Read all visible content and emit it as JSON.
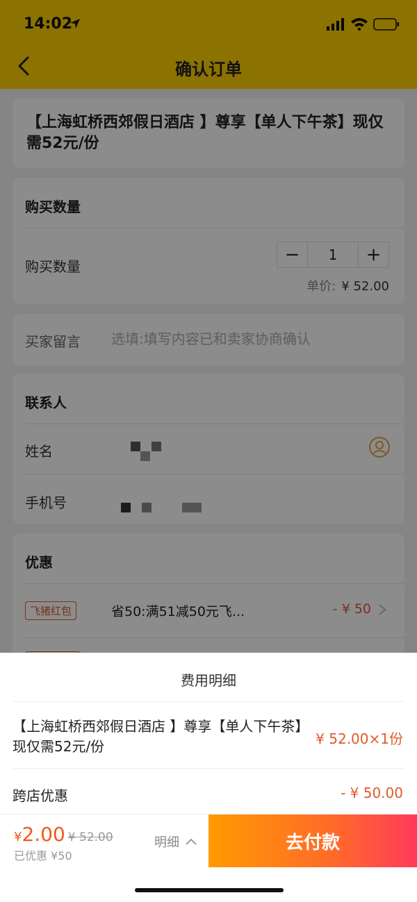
{
  "status_bar": {
    "time": "14:02"
  },
  "header": {
    "title": "确认订单"
  },
  "product": {
    "title": "【上海虹桥西郊假日酒店 】尊享【单人下午茶】现仅需52元/份"
  },
  "quantity": {
    "heading": "购买数量",
    "label": "购买数量",
    "minus": "−",
    "value": "1",
    "plus": "+",
    "unit_price_label": "单价:",
    "unit_price": "¥ 52.00"
  },
  "message": {
    "label": "买家留言",
    "placeholder": "选填:填写内容已和卖家协商确认"
  },
  "contact": {
    "heading": "联系人",
    "name_label": "姓名",
    "phone_label": "手机号"
  },
  "discount": {
    "heading": "优惠",
    "items": [
      {
        "tag": "飞猪红包",
        "desc": "省50:满51减50元飞...",
        "amount": "- ¥ 50"
      }
    ]
  },
  "fee_sheet": {
    "title": "费用明细",
    "item_name": "【上海虹桥西郊假日酒店 】尊享【单人下午茶】现仅需52元/份",
    "item_price": "¥ 52.00×1份",
    "discount_label": "跨店优惠",
    "discount_amount": "- ¥ 50.00"
  },
  "footer": {
    "currency": "¥",
    "total": "2.00",
    "original": "¥ 52.00",
    "saved": "已优惠 ¥50",
    "detail_label": "明细",
    "pay_label": "去付款"
  },
  "colors": {
    "brand_yellow": "#ffd000",
    "accent_orange": "#e05a2a",
    "pay_gradient_start": "#ff9a00",
    "pay_gradient_end": "#ff3a5a"
  }
}
